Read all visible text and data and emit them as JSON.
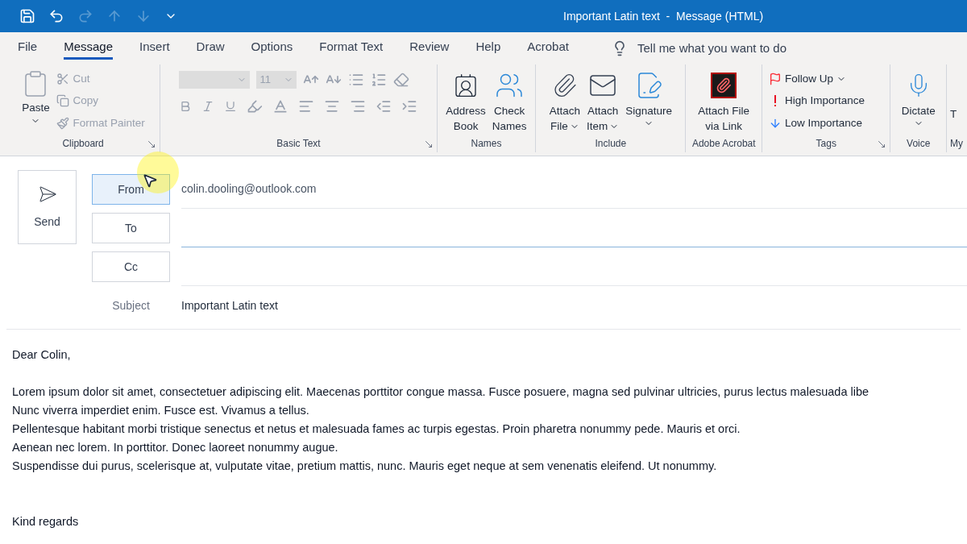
{
  "title_bar": {
    "title": "Important Latin text  -  Message (HTML)"
  },
  "tabs": [
    {
      "label": "File",
      "selected": false
    },
    {
      "label": "Message",
      "selected": true
    },
    {
      "label": "Insert",
      "selected": false
    },
    {
      "label": "Draw",
      "selected": false
    },
    {
      "label": "Options",
      "selected": false
    },
    {
      "label": "Format Text",
      "selected": false
    },
    {
      "label": "Review",
      "selected": false
    },
    {
      "label": "Help",
      "selected": false
    },
    {
      "label": "Acrobat",
      "selected": false
    }
  ],
  "tell_me": {
    "placeholder": "Tell me what you want to do"
  },
  "ribbon": {
    "clipboard": {
      "label": "Clipboard",
      "paste": {
        "label": "Paste"
      },
      "items": [
        {
          "label": "Cut",
          "disabled": true
        },
        {
          "label": "Copy",
          "disabled": true
        },
        {
          "label": "Format Painter",
          "disabled": true
        }
      ]
    },
    "basic_text": {
      "label": "Basic Text",
      "font_size": "11",
      "disabled": true
    },
    "names": {
      "label": "Names",
      "buttons": [
        {
          "line1": "Address",
          "line2": "Book"
        },
        {
          "line1": "Check",
          "line2": "Names"
        }
      ]
    },
    "include": {
      "label": "Include",
      "buttons": [
        {
          "line1": "Attach",
          "line2": "File"
        },
        {
          "line1": "Attach",
          "line2": "Item"
        },
        {
          "line1": "Signature"
        }
      ]
    },
    "acrobat": {
      "label": "Adobe Acrobat",
      "line1": "Attach File",
      "line2": "via Link"
    },
    "tags": {
      "label": "Tags",
      "items": [
        {
          "label": "Follow Up"
        },
        {
          "label": "High Importance"
        },
        {
          "label": "Low Importance"
        }
      ]
    },
    "voice": {
      "label": "Voice",
      "button": "Dictate"
    },
    "partial_group": {
      "button": "T",
      "label": "My"
    }
  },
  "header": {
    "send": "Send",
    "from": {
      "label": "From",
      "value": "colin.dooling@outlook.com"
    },
    "to": {
      "label": "To"
    },
    "cc": {
      "label": "Cc"
    },
    "subject": {
      "label": "Subject",
      "value": "Important Latin text"
    }
  },
  "body": [
    [
      "Dear Colin,"
    ],
    [
      "Lorem ipsum dolor sit amet, consectetuer adipiscing elit. Maecenas porttitor congue massa. Fusce posuere, magna sed pulvinar ultricies, purus lectus malesuada libe",
      "Nunc viverra imperdiet enim. Fusce est. Vivamus a tellus.",
      "Pellentesque habitant morbi tristique senectus et netus et malesuada fames ac turpis egestas. Proin pharetra nonummy pede. Mauris et orci.",
      "Aenean nec lorem. In porttitor. Donec laoreet nonummy augue.",
      "Suspendisse dui purus, scelerisque at, vulputate vitae, pretium mattis, nunc. Mauris eget neque at sem venenatis eleifend. Ut nonummy."
    ],
    [
      "Kind regards"
    ]
  ]
}
